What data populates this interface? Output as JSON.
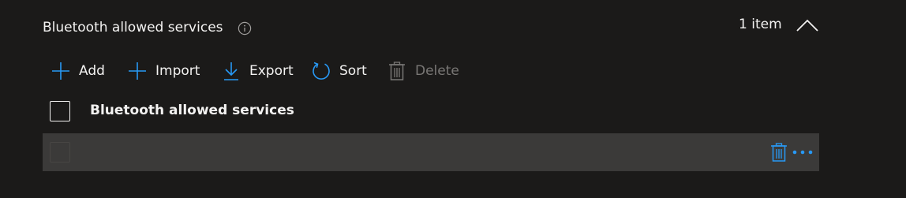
{
  "section": {
    "title": "Bluetooth allowed services",
    "info_icon": "info-icon",
    "item_count": "1 item",
    "collapse_icon": "chevron-up-icon"
  },
  "toolbar": {
    "add_label": "Add",
    "import_label": "Import",
    "export_label": "Export",
    "sort_label": "Sort",
    "delete_label": "Delete",
    "delete_disabled": true
  },
  "table": {
    "columns": [
      "Bluetooth allowed services"
    ],
    "rows": [
      {
        "value": "",
        "actions": [
          "trash-icon",
          "more-icon"
        ]
      }
    ]
  },
  "colors": {
    "background": "#1b1a19",
    "text": "#f3f2f1",
    "accent": "#2899f5",
    "disabled": "#797775",
    "row_background": "#3b3a39"
  }
}
